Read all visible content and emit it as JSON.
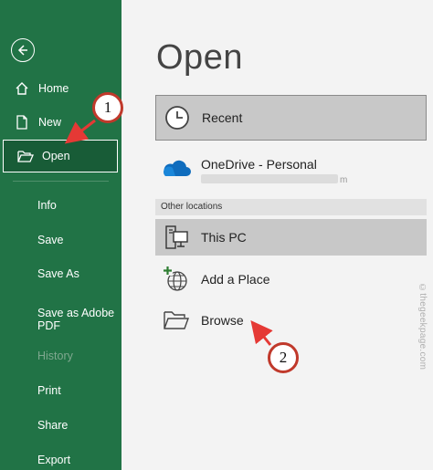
{
  "sidebar": {
    "back_icon": "back-arrow-circle-icon",
    "items": [
      {
        "label": "Home",
        "icon": "home-icon"
      },
      {
        "label": "New",
        "icon": "new-document-icon"
      },
      {
        "label": "Open",
        "icon": "open-folder-icon",
        "selected": true
      },
      {
        "label": "Info"
      },
      {
        "label": "Save"
      },
      {
        "label": "Save As"
      },
      {
        "label": "Save as Adobe\nPDF"
      },
      {
        "label": "History",
        "disabled": true
      },
      {
        "label": "Print"
      },
      {
        "label": "Share"
      },
      {
        "label": "Export"
      }
    ]
  },
  "main": {
    "title": "Open",
    "recent": {
      "label": "Recent",
      "icon": "clock-icon"
    },
    "onedrive": {
      "label": "OneDrive - Personal",
      "sub_tail": "m",
      "icon": "cloud-icon"
    },
    "section_header": "Other locations",
    "locations": [
      {
        "label": "This PC",
        "icon": "computer-icon"
      },
      {
        "label": "Add a Place",
        "icon": "globe-add-icon"
      },
      {
        "label": "Browse",
        "icon": "folder-open-icon"
      }
    ]
  },
  "annotations": {
    "badge1": "1",
    "badge2": "2",
    "color": "#e53935"
  },
  "watermark": "©thegeekpage.com",
  "colors": {
    "sidebar": "#217346",
    "selected": "#185c37",
    "highlight": "#c8c8c8"
  }
}
